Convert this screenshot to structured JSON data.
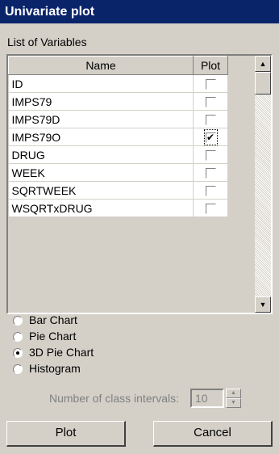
{
  "window": {
    "title": "Univariate plot"
  },
  "list": {
    "caption": "List of Variables",
    "columns": {
      "name": "Name",
      "plot": "Plot"
    },
    "rows": [
      {
        "name": "ID",
        "checked": false
      },
      {
        "name": "IMPS79",
        "checked": false
      },
      {
        "name": "IMPS79D",
        "checked": false
      },
      {
        "name": "IMPS79O",
        "checked": true
      },
      {
        "name": "DRUG",
        "checked": false
      },
      {
        "name": "WEEK",
        "checked": false
      },
      {
        "name": "SQRTWEEK",
        "checked": false
      },
      {
        "name": "WSQRTxDRUG",
        "checked": false
      }
    ]
  },
  "chart_types": {
    "options": [
      "Bar Chart",
      "Pie Chart",
      "3D Pie Chart",
      "Histogram"
    ],
    "selected": "3D Pie Chart"
  },
  "intervals": {
    "label": "Number of class intervals:",
    "value": "10",
    "enabled": false
  },
  "buttons": {
    "plot": "Plot",
    "cancel": "Cancel"
  },
  "icons": {
    "scroll_up": "arrow-up-icon",
    "scroll_down": "arrow-down-icon",
    "spin_up": "spin-up-icon",
    "spin_down": "spin-down-icon"
  }
}
